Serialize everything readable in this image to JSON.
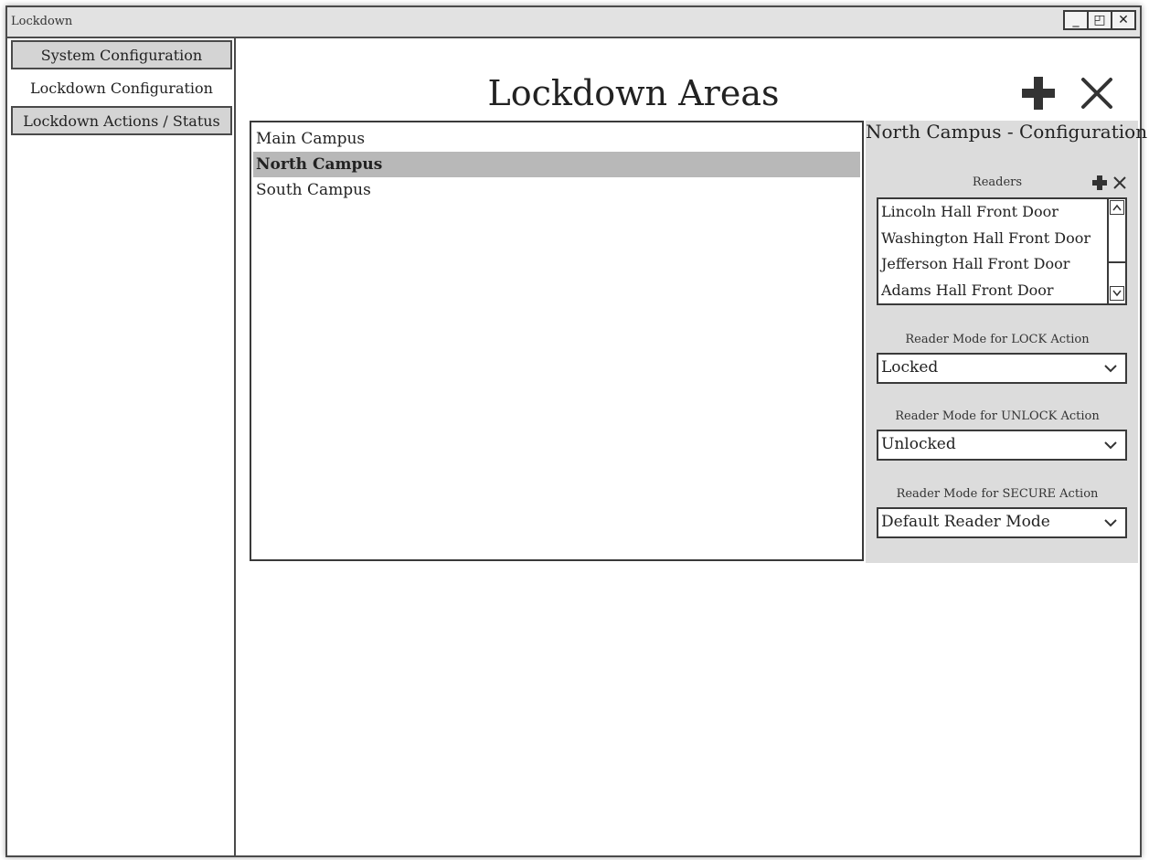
{
  "window": {
    "title": "Lockdown",
    "controls": {
      "minimize": "_",
      "restore": "◰",
      "close": "✕"
    }
  },
  "sidebar": {
    "items": [
      {
        "label": "System Configuration",
        "active": false
      },
      {
        "label": "Lockdown Configuration",
        "active": true
      },
      {
        "label": "Lockdown Actions / Status",
        "active": false
      }
    ]
  },
  "main": {
    "heading": "Lockdown Areas",
    "toolbar": {
      "add_icon": "plus-icon",
      "delete_icon": "x-icon"
    },
    "areas": [
      {
        "label": "Main Campus",
        "selected": false
      },
      {
        "label": "North Campus",
        "selected": true
      },
      {
        "label": "South Campus",
        "selected": false
      }
    ]
  },
  "config": {
    "title": "North Campus - Configuration",
    "readers_label": "Readers",
    "readers": [
      "Lincoln Hall Front Door",
      "Washington Hall Front Door",
      "Jefferson Hall Front Door",
      "Adams Hall Front Door"
    ],
    "lock": {
      "label": "Reader Mode for LOCK Action",
      "value": "Locked"
    },
    "unlock": {
      "label": "Reader Mode for UNLOCK Action",
      "value": "Unlocked"
    },
    "secure": {
      "label": "Reader Mode for SECURE Action",
      "value": "Default Reader Mode"
    }
  },
  "colors": {
    "selection": "#b8b8b8",
    "panel": "#dcdcdc",
    "tab": "#d4d4d4",
    "border": "#3a3a3a"
  }
}
